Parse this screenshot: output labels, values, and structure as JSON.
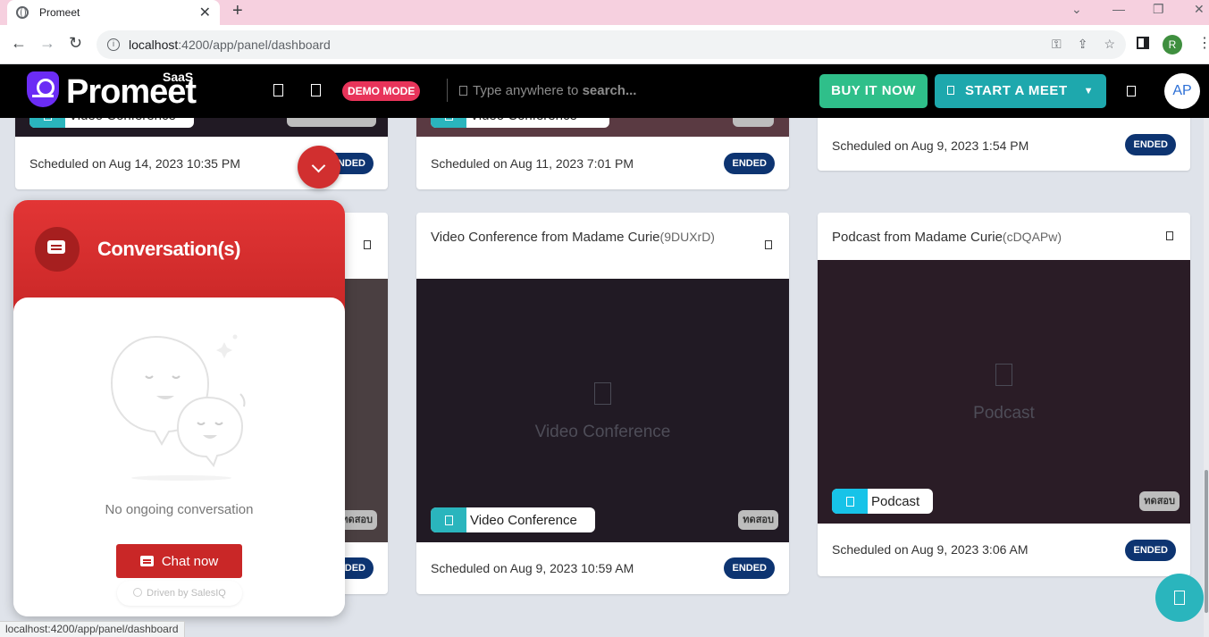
{
  "browser": {
    "tab_title": "Promeet",
    "tab_close": "✕",
    "new_tab": "+",
    "url_host": "localhost",
    "url_path": ":4200/app/panel/dashboard",
    "profile_initial": "R",
    "status_url": "localhost:4200/app/panel/dashboard"
  },
  "header": {
    "logo_text": "Promeet",
    "logo_sub": "SaaS",
    "demo_badge": "DEMO MODE",
    "search_placeholder": "Type anywhere to",
    "search_keyword": "search...",
    "buy_label": "BUY IT NOW",
    "start_label": "START A MEET",
    "avatar_initials": "AP"
  },
  "cards": [
    {
      "type_label": "Video Conference",
      "schedule": "Scheduled on Aug 14, 2023 10:35 PM",
      "status": "ENDED"
    },
    {
      "type_label": "Video Conference",
      "schedule": "Scheduled on Aug 11, 2023 7:01 PM",
      "status": "ENDED"
    },
    {
      "schedule": "Scheduled on Aug 9, 2023 1:54 PM",
      "status": "ENDED"
    },
    {
      "tag": "ทดสอบ",
      "status": "ENDED"
    },
    {
      "title": "Video Conference from Madame Curie",
      "code": "(9DUXrD)",
      "media_label": "Video Conference",
      "type_label": "Video Conference",
      "tag": "ทดสอบ",
      "schedule": "Scheduled on Aug 9, 2023 10:59 AM",
      "status": "ENDED"
    },
    {
      "title": "Podcast from Madame Curie",
      "code": "(cDQAPw)",
      "media_label": "Podcast",
      "type_label": "Podcast",
      "tag": "ทดสอบ",
      "schedule": "Scheduled on Aug 9, 2023 3:06 AM",
      "status": "ENDED"
    }
  ],
  "chat": {
    "title": "Conversation(s)",
    "empty_text": "No ongoing conversation",
    "chat_now": "Chat now",
    "driven_by": "Driven by SalesIQ"
  },
  "colors": {
    "header_bg": "#000000",
    "buy_green": "#2fbf8a",
    "start_teal": "#1ea8ad",
    "demo_red": "#e8345a",
    "ended_navy": "#0d3471",
    "chat_red": "#c92727",
    "media_dark": "#211a24",
    "podcast_pill": "#17c3e8"
  }
}
